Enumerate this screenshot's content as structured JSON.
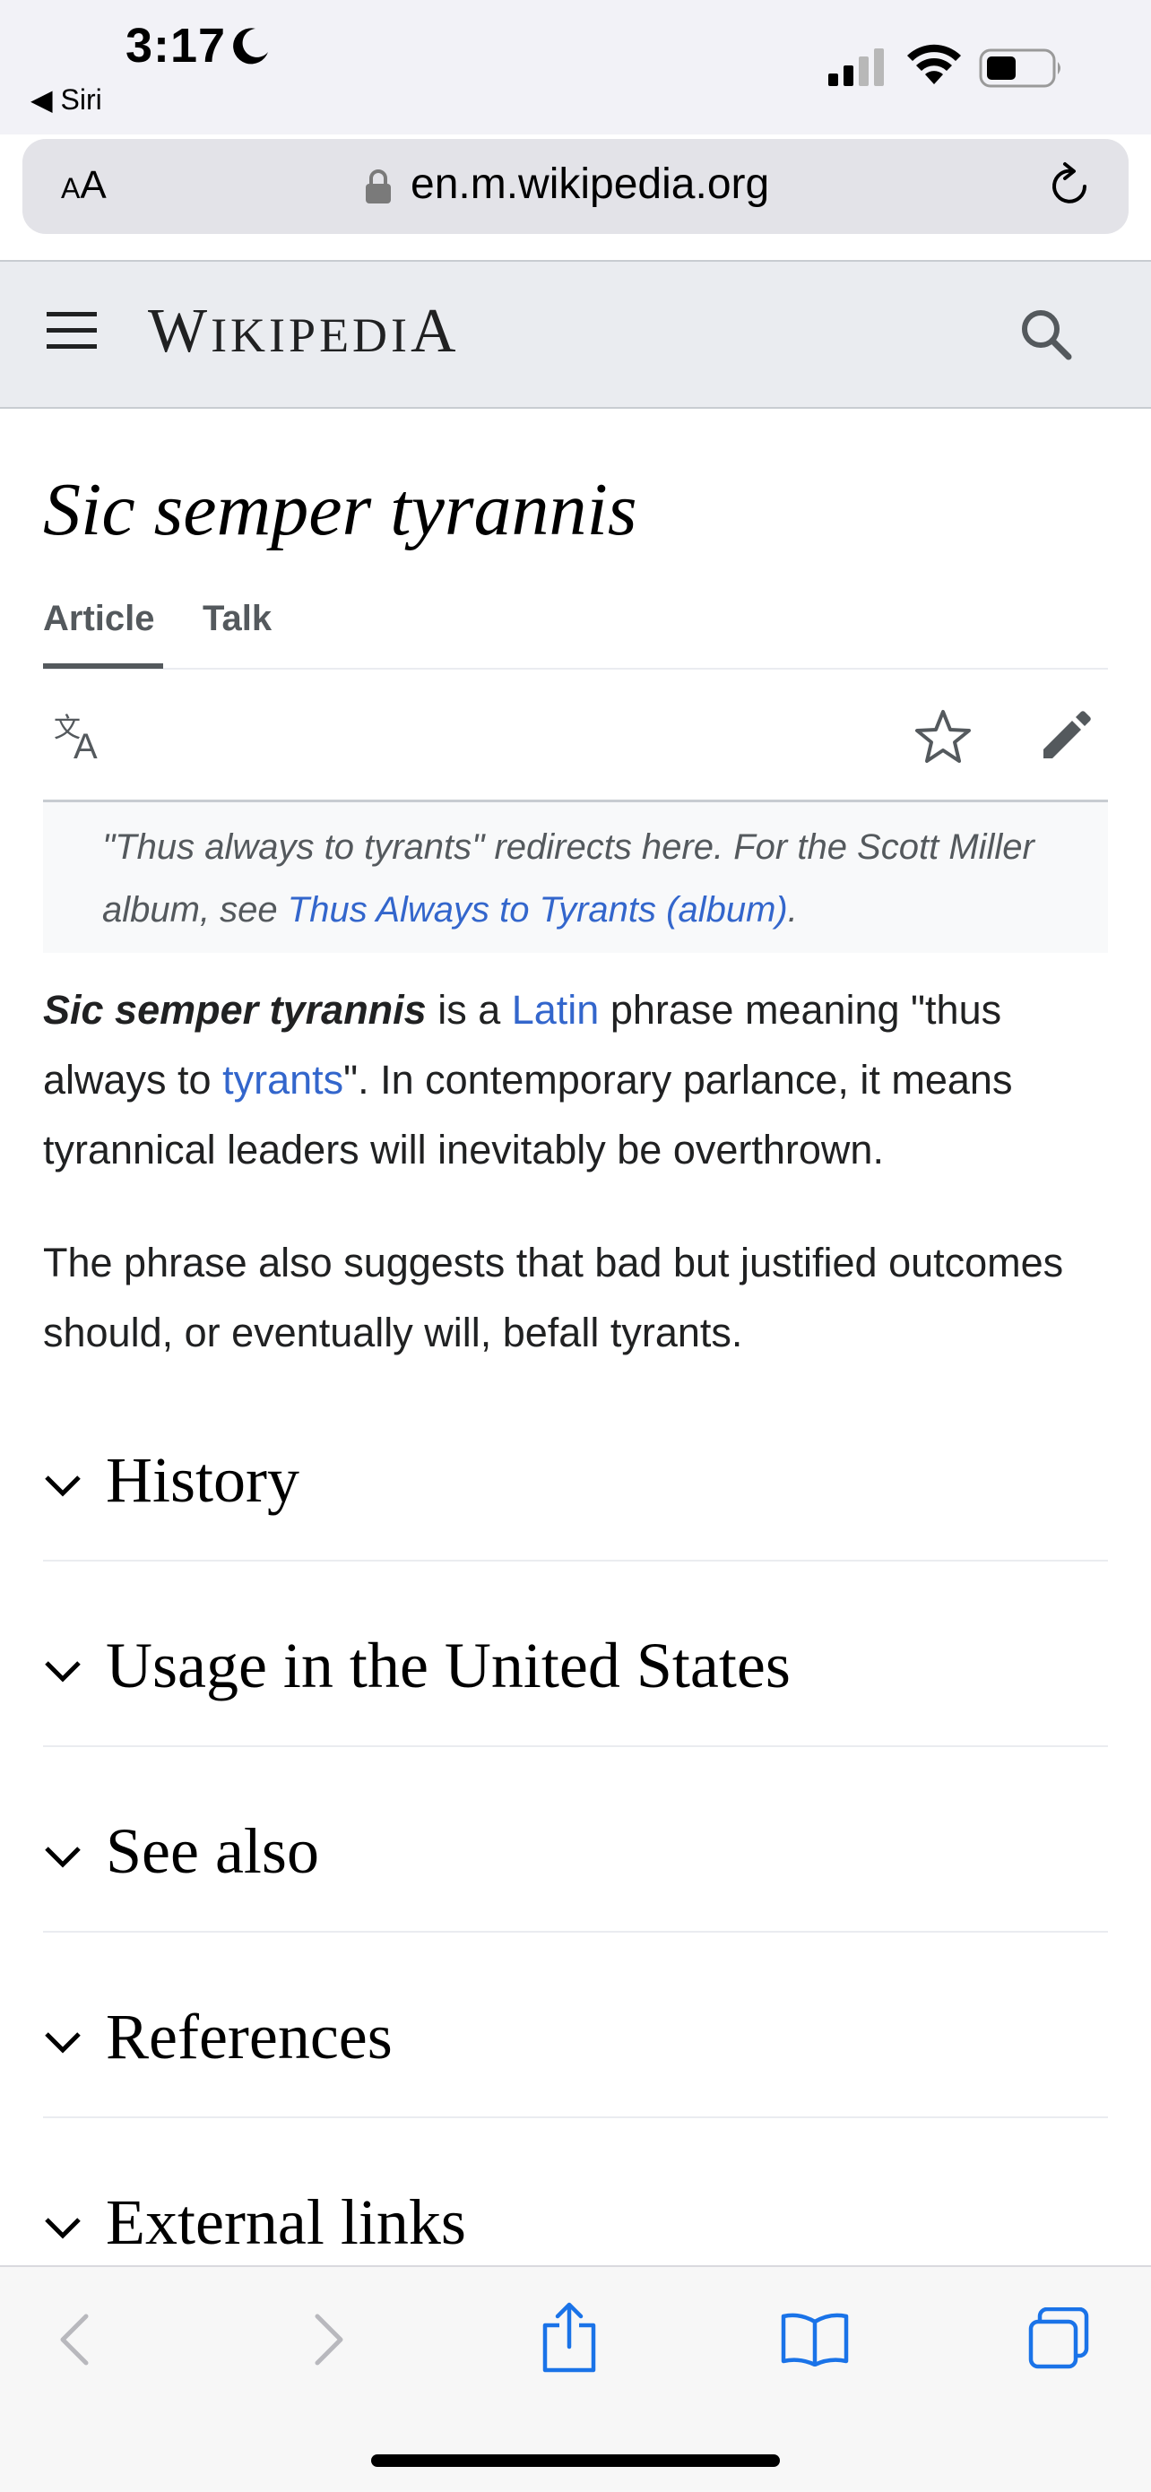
{
  "status_bar": {
    "time": "3:17",
    "back_app": "Siri"
  },
  "browser": {
    "text_size_label_small": "A",
    "text_size_label_large": "A",
    "url": "en.m.wikipedia.org"
  },
  "header": {
    "wordmark_initial": "W",
    "wordmark_middle": "IKIPEDI",
    "wordmark_final": "A"
  },
  "page": {
    "title": "Sic semper tyrannis",
    "tabs": [
      {
        "label": "Article",
        "selected": true
      },
      {
        "label": "Talk",
        "selected": false
      }
    ],
    "hatnote": {
      "prefix": "\"Thus always to tyrants\" redirects here. For the Scott Miller album, see ",
      "link": "Thus Always to Tyrants (album)",
      "suffix": "."
    },
    "para1": {
      "bold": "Sic semper tyrannis",
      "t1": " is a ",
      "link1": "Latin",
      "t2": " phrase meaning \"thus always to ",
      "link2": "tyrants",
      "t3": "\". In contemporary parlance, it means tyrannical leaders will inevitably be overthrown."
    },
    "para2": "The phrase also suggests that bad but justified outcomes should, or eventually will, befall tyrants.",
    "sections": [
      {
        "heading": "History"
      },
      {
        "heading": "Usage in the United States"
      },
      {
        "heading": "See also"
      },
      {
        "heading": "References"
      },
      {
        "heading": "External links"
      }
    ]
  },
  "colors": {
    "link": "#3366cc",
    "header_bg": "#eaecf0",
    "safari_blue": "#1a73e8"
  }
}
